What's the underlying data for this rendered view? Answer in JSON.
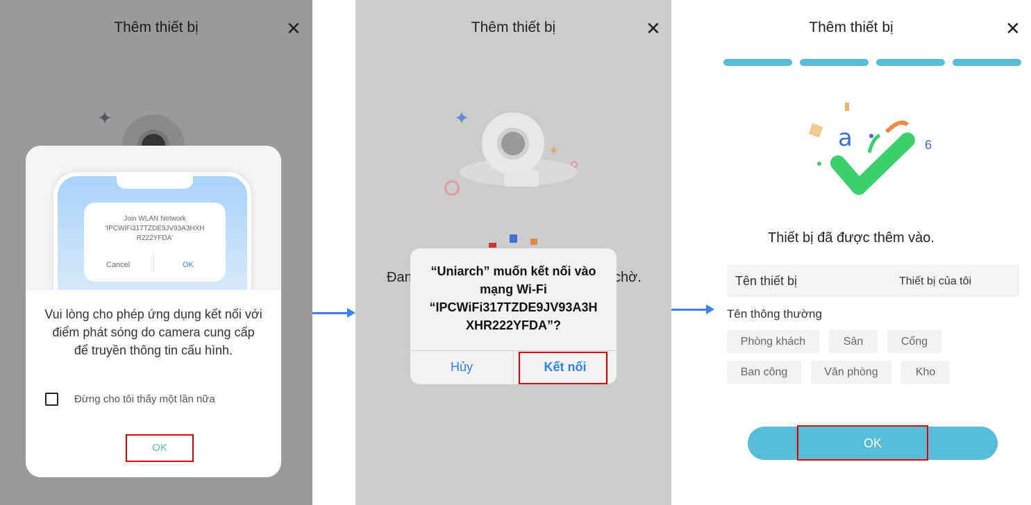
{
  "panel1": {
    "title": "Thêm thiết bị",
    "close_icon": "close-icon",
    "illustration": {
      "dialog_title": "Join WLAN Network",
      "ssid_line1": "'IPCWiFi317TZDE9JV93A3HXH",
      "ssid_line2": "R222YFDA'",
      "cancel": "Cancel",
      "ok": "OK"
    },
    "message": "Vui lòng cho phép ứng dụng kết nối với điểm phát sóng do camera cung cấp để truyền thông tin cấu hình.",
    "checkbox_label": "Đừng cho tôi thấy một lần nữa",
    "checkbox_checked": false,
    "ok_label": "OK"
  },
  "panel2": {
    "title": "Thêm thiết bị",
    "bg_text_left": "Đan",
    "bg_text_right": "chờ.",
    "alert": {
      "line1": "“Uniarch” muốn kết nối vào",
      "line2": "mạng Wi-Fi",
      "line3": "“IPCWiFi317TZDE9JV93A3H",
      "line4": "XHR222YFDA”?",
      "cancel": "Hủy",
      "connect": "Kết nối"
    }
  },
  "panel3": {
    "title": "Thêm thiết bị",
    "progress_steps_completed": 4,
    "progress_steps_total": 4,
    "success_text": "Thiết bị đã được thêm vào.",
    "device_name_label": "Tên thiết bị",
    "device_name_value": "Thiết bị của tôi",
    "common_names_label": "Tên thông thường",
    "tags": [
      "Phòng khách",
      "Sân",
      "Cổng",
      "Ban công",
      "Văn phòng",
      "Kho"
    ],
    "ok_label": "OK"
  },
  "colors": {
    "accent": "#56bcd8",
    "ios_blue": "#2f80ed",
    "highlight": "#e00000",
    "success": "#3ccf6e",
    "arrow": "#3b82f6"
  }
}
